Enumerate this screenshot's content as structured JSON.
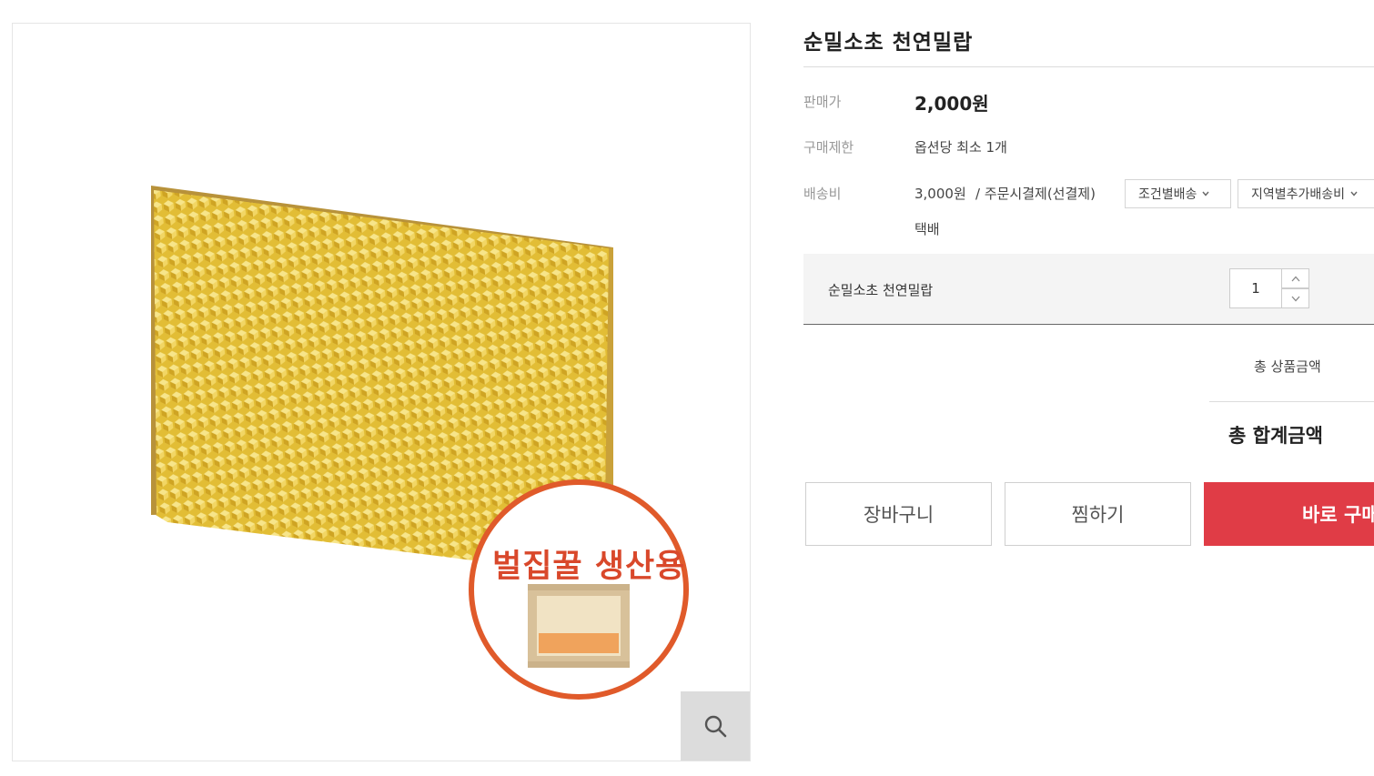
{
  "product": {
    "title": "순밀소초 천연밀랍",
    "badge_text": "벌집꿀 생산용"
  },
  "info": {
    "price_label": "판매가",
    "price_value": "2,000원",
    "limit_label": "구매제한",
    "limit_value": "옵션당 최소 1개",
    "shipping_label": "배송비",
    "shipping_fee": "3,000원",
    "shipping_payment": "/ 주문시결제(선결제)",
    "shipping_method": "택배",
    "shipping_option_1": "조건별배송",
    "shipping_option_2": "지역별추가배송비"
  },
  "option": {
    "name": "순밀소초 천연밀랍",
    "quantity": "1"
  },
  "totals": {
    "product_total_label": "총 상품금액",
    "grand_total_label": "총 합계금액"
  },
  "actions": {
    "cart_label": "장바구니",
    "wish_label": "찜하기",
    "buy_label": "바로 구매"
  },
  "icons": {
    "zoom": "search-icon",
    "dropdown": "chevron-down-icon",
    "qty_up": "chevron-up-icon",
    "qty_down": "chevron-down-icon"
  },
  "colors": {
    "buy_button": "#e03c46",
    "badge_ring": "#e05a2a",
    "badge_text": "#d9482b",
    "comb_yellow": "#e6c23a"
  }
}
